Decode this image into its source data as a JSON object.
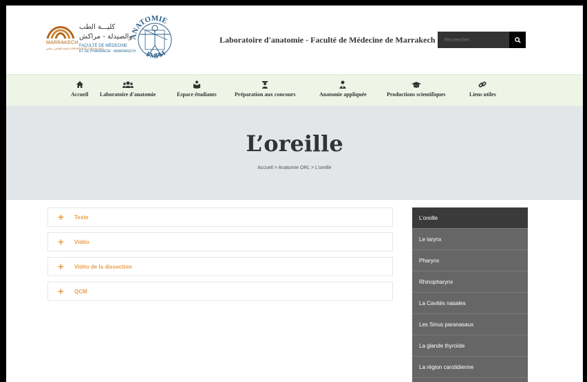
{
  "header": {
    "faculty_logo": {
      "arabic_line1": "كليـــة الطب",
      "arabic_line2": "والصيدلة - مراكش",
      "city": "MARRAKECH",
      "french_line1": "FACULTÉ DE MÉDECINE",
      "french_line2": "ET DE PHARMACIE - MARRAKECH",
      "university_small": "جامعة القاضي عياض UNIVERSITÉ CADI AYYAD"
    },
    "anatomy_logo": {
      "top": "ANATOMIE",
      "bottom": "FMPM"
    },
    "site_title": "Laboratoire d'anatomie - Faculté de Médecine de Marrakech",
    "search": {
      "placeholder": "Rechercher..."
    }
  },
  "nav": {
    "items": [
      {
        "label": "Accueil",
        "icon": "home-icon"
      },
      {
        "label": "Laboratoire d'anatomie",
        "icon": "users-icon"
      },
      {
        "label": "Espace étudiants",
        "icon": "reader-icon"
      },
      {
        "label": "Préparation aux concours",
        "icon": "teacher-icon"
      },
      {
        "label": "Anatomie appliquée",
        "icon": "doctor-icon"
      },
      {
        "label": "Productions scientifiques",
        "icon": "graduation-cap-icon"
      },
      {
        "label": "Liens utiles",
        "icon": "link-icon"
      }
    ]
  },
  "page": {
    "title": "L’oreille",
    "breadcrumb": "Accueil > Anatomie ORL > L’oreille"
  },
  "accordion": {
    "items": [
      {
        "label": "Texte"
      },
      {
        "label": "Vidéo"
      },
      {
        "label": "Vidéo de la dissection"
      },
      {
        "label": "QCM"
      }
    ]
  },
  "sidebar": {
    "items": [
      {
        "label": "L’oreille",
        "active": true
      },
      {
        "label": "Le larynx"
      },
      {
        "label": "Pharynx"
      },
      {
        "label": "Rhinopharynx"
      },
      {
        "label": "La Cavités nasales"
      },
      {
        "label": "Les Sinus paranasaux"
      },
      {
        "label": "La glande thyroïde"
      },
      {
        "label": "La région carotidienne"
      }
    ]
  },
  "colors": {
    "accent": "#e8a04a",
    "nav_bg": "#eef5e6",
    "title_band": "#e2e6e9",
    "sidebar_bg": "#666666",
    "sidebar_active": "#3a3a3a"
  }
}
